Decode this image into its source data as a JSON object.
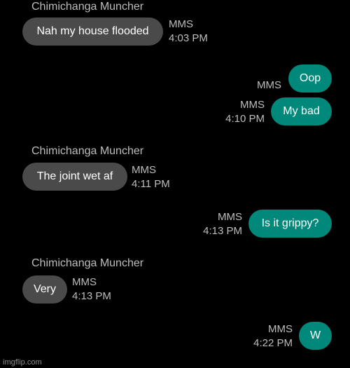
{
  "messages": [
    {
      "direction": "incoming",
      "sender": "Chimichanga Muncher",
      "text": "Nah my house flooded",
      "type": "MMS",
      "time": "4:03 PM"
    },
    {
      "direction": "outgoing",
      "text": "Oop",
      "type": "MMS",
      "time": ""
    },
    {
      "direction": "outgoing",
      "text": "My bad",
      "type": "MMS",
      "time": "4:10 PM"
    },
    {
      "direction": "incoming",
      "sender": "Chimichanga Muncher",
      "text": "The joint wet af",
      "type": "MMS",
      "time": "4:11 PM"
    },
    {
      "direction": "outgoing",
      "text": "Is it grippy?",
      "type": "MMS",
      "time": "4:13 PM"
    },
    {
      "direction": "incoming",
      "sender": "Chimichanga Muncher",
      "text": "Very",
      "type": "MMS",
      "time": "4:13 PM"
    },
    {
      "direction": "outgoing",
      "text": "W",
      "type": "MMS",
      "time": "4:22 PM"
    }
  ],
  "watermark": "imgflip.com",
  "colors": {
    "incoming_bubble": "#4a4a4a",
    "outgoing_bubble": "#00897b",
    "background": "#000000"
  }
}
